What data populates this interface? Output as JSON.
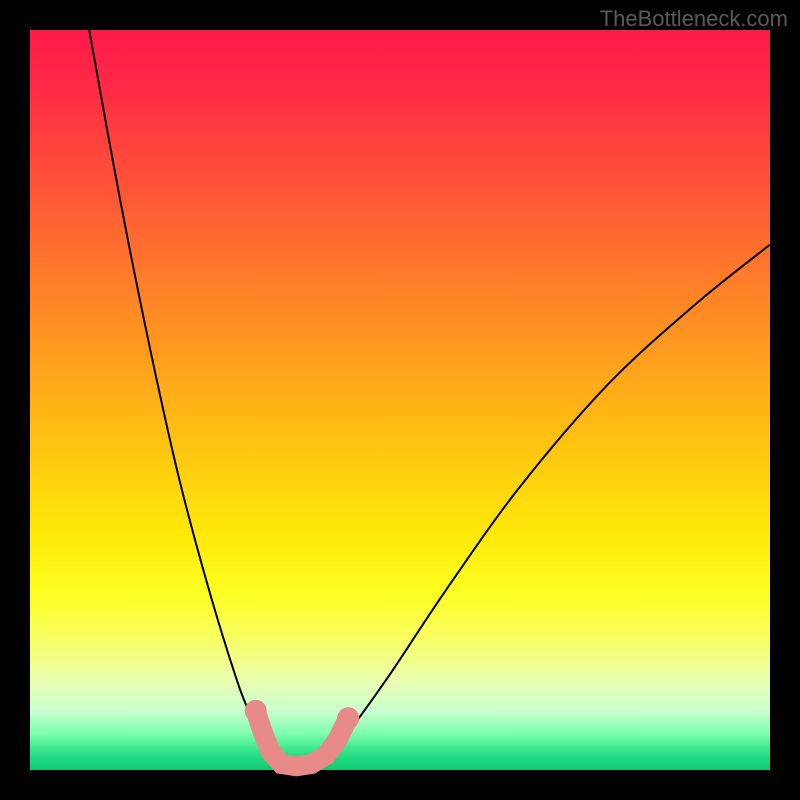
{
  "watermark": "TheBottleneck.com",
  "chart_data": {
    "type": "line",
    "title": "",
    "xlabel": "",
    "ylabel": "",
    "xlim": [
      0,
      100
    ],
    "ylim": [
      0,
      100
    ],
    "grid": false,
    "series": [
      {
        "name": "left-curve",
        "x": [
          8,
          12,
          16,
          20,
          24,
          28,
          30,
          32,
          34,
          35.5
        ],
        "values": [
          100,
          78,
          58,
          40,
          25,
          12,
          7,
          3,
          1,
          0
        ]
      },
      {
        "name": "right-curve",
        "x": [
          35.5,
          38,
          42,
          48,
          56,
          66,
          78,
          90,
          100
        ],
        "values": [
          0,
          1,
          4,
          12,
          24,
          38,
          52,
          63,
          71
        ]
      }
    ],
    "markers": {
      "name": "data-points",
      "color": "#e88a8a",
      "points": [
        {
          "x": 30.5,
          "y": 8
        },
        {
          "x": 31.5,
          "y": 5
        },
        {
          "x": 32.5,
          "y": 2.5
        },
        {
          "x": 34,
          "y": 0.8
        },
        {
          "x": 36,
          "y": 0.5
        },
        {
          "x": 38,
          "y": 0.8
        },
        {
          "x": 40,
          "y": 2
        },
        {
          "x": 41.5,
          "y": 4
        },
        {
          "x": 43,
          "y": 7
        }
      ]
    }
  }
}
